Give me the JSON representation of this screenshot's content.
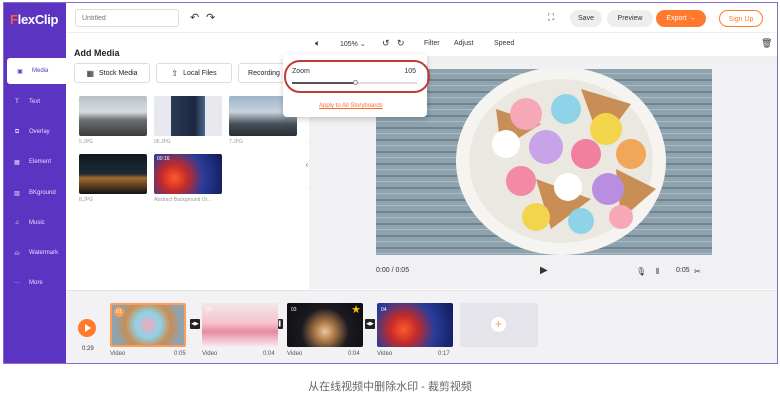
{
  "app": {
    "logo_f": "F",
    "logo_rest": "lexClip"
  },
  "topbar": {
    "title_placeholder": "Untitled",
    "save": "Save",
    "preview": "Preview",
    "export": "Export →",
    "signup": "Sign Up"
  },
  "sidebar": {
    "items": [
      {
        "label": "Media",
        "icon": "media-icon",
        "glyph": "▣"
      },
      {
        "label": "Text",
        "icon": "text-icon",
        "glyph": "T"
      },
      {
        "label": "Overlay",
        "icon": "overlay-icon",
        "glyph": "⧉"
      },
      {
        "label": "Element",
        "icon": "element-icon",
        "glyph": "▦"
      },
      {
        "label": "BKground",
        "icon": "background-icon",
        "glyph": "▨"
      },
      {
        "label": "Music",
        "icon": "music-icon",
        "glyph": "♫"
      },
      {
        "label": "Watermark",
        "icon": "watermark-icon",
        "glyph": "⛀"
      },
      {
        "label": "More",
        "icon": "more-icon",
        "glyph": "···"
      }
    ]
  },
  "media": {
    "heading": "Add Media",
    "stock_btn": "Stock Media",
    "local_btn": "Local Files",
    "record_btn": "Recording",
    "items": [
      {
        "name": "5.JPG",
        "badge": ""
      },
      {
        "name": "06.JPG",
        "badge": ""
      },
      {
        "name": "7.JPG",
        "badge": ""
      },
      {
        "name": "8.JPG",
        "badge": ""
      },
      {
        "name": "Abstract Background Or...",
        "badge": "00:16"
      }
    ]
  },
  "toolbar": {
    "zoom_value": "105%",
    "filter": "Filter",
    "adjust": "Adjust",
    "speed": "Speed"
  },
  "zoom_popup": {
    "label": "Zoom",
    "value": "105",
    "apply_all": "Apply to All Storyboards"
  },
  "player": {
    "current_time": "0:00 / 0:05",
    "right_time": "0:05"
  },
  "timeline": {
    "total": "0:29",
    "clips": [
      {
        "index": "01",
        "name": "Video",
        "duration": "0:05"
      },
      {
        "index": "02",
        "name": "Video",
        "duration": "0:04"
      },
      {
        "index": "03",
        "name": "Video",
        "duration": "0:04"
      },
      {
        "index": "04",
        "name": "Video",
        "duration": "0:17"
      }
    ]
  },
  "caption": "从在线视频中删除水印 - 裁剪视频",
  "colors": {
    "brand": "#5b34c2",
    "accent": "#ff7a2d",
    "highlight": "#c23a3a"
  }
}
